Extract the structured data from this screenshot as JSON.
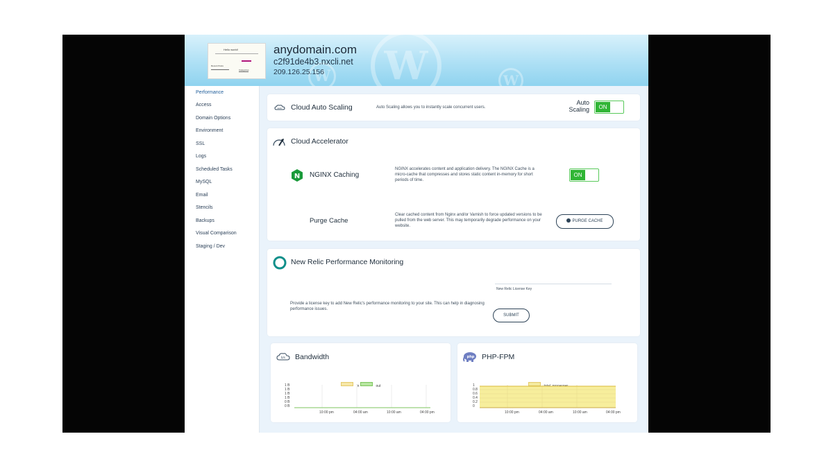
{
  "site": {
    "title": "anydomain.com",
    "hostname": "c2f91de4b3.nxcli.net",
    "ip": "209.126.25.156",
    "thumbnail_text": [
      "Hello world!",
      "Recent Posts",
      "Categories"
    ]
  },
  "sidebar": {
    "items": [
      {
        "label": "Performance",
        "active": true
      },
      {
        "label": "Access"
      },
      {
        "label": "Domain Options"
      },
      {
        "label": "Environment"
      },
      {
        "label": "SSL"
      },
      {
        "label": "Logs"
      },
      {
        "label": "Scheduled Tasks"
      },
      {
        "label": "MySQL"
      },
      {
        "label": "Email"
      },
      {
        "label": "Stencils"
      },
      {
        "label": "Backups"
      },
      {
        "label": "Visual Comparison"
      },
      {
        "label": "Staging / Dev"
      }
    ]
  },
  "auto_scaling": {
    "title": "Cloud Auto Scaling",
    "description": "Auto Scaling allows you to instantly scale concurrent users.",
    "toggle_label_line1": "Auto",
    "toggle_label_line2": "Scaling",
    "toggle_state": "ON",
    "icon": "auto-scaling-icon"
  },
  "accelerator": {
    "title": "Cloud Accelerator",
    "icon": "accelerator-gauge-icon",
    "nginx": {
      "label": "NGINX Caching",
      "icon": "nginx-icon",
      "description": "NGINX accelerates content and application delivery. The NGINX Cache is a micro-cache that compresses and stores static content in-memory for short periods of time.",
      "toggle_state": "ON"
    },
    "purge": {
      "label": "Purge Cache",
      "description": "Clear cached content from Nginx and/or Varnish to force updated versions to be pulled from the web server. This may temporarily degrade performance on your website.",
      "button_label": "PURGE CACHE"
    }
  },
  "new_relic": {
    "title": "New Relic Performance Monitoring",
    "icon": "new-relic-icon",
    "description": "Provide a license key to add New Relic's performance monitoring to your site. This can help in diagnosing performance issues.",
    "license_label": "New Relic License Key",
    "license_value": "",
    "submit_label": "SUBMIT"
  },
  "colors": {
    "toggle_green": "#2fb534",
    "header_blue": "#8fd3ef",
    "series_in": "#f6e7a8",
    "series_out": "#b8e6a2",
    "series_total": "#f4ea9f"
  },
  "chart_data": [
    {
      "type": "line",
      "title": "Bandwidth",
      "icon": "bandwidth-icon",
      "series": [
        {
          "name": "in",
          "values": [
            0,
            0,
            0,
            0,
            0,
            0
          ]
        },
        {
          "name": "out",
          "values": [
            0,
            0,
            0,
            0,
            0,
            0
          ]
        }
      ],
      "x_ticks": [
        "10:00 pm",
        "04:00 am",
        "10:00 am",
        "04:00 pm"
      ],
      "y_ticks": [
        "1 B",
        "1 B",
        "1 B",
        "1 B",
        "0 B",
        "0 B"
      ],
      "legend": "top-center"
    },
    {
      "type": "area",
      "title": "PHP-FPM",
      "icon": "php-elephant-icon",
      "series": [
        {
          "name": "total_processes",
          "values": [
            1,
            1,
            1,
            1,
            1,
            1
          ]
        }
      ],
      "x_ticks": [
        "10:00 pm",
        "04:00 am",
        "10:00 am",
        "04:00 pm"
      ],
      "y_ticks": [
        "1",
        "0.8",
        "0.6",
        "0.4",
        "0.2",
        "0"
      ],
      "ylim": [
        0,
        1
      ],
      "legend": "top-center"
    }
  ]
}
